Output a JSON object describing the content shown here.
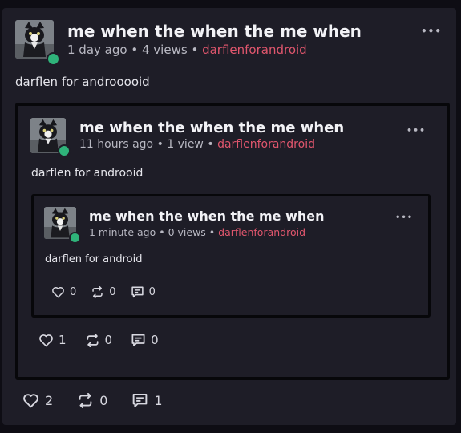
{
  "outer": {
    "title": "me when the when the me when",
    "time": "1 day ago",
    "views": "4 views",
    "author": "darflenforandroid",
    "body": "darflen for androoooid",
    "likes": "2",
    "reposts": "0",
    "comments": "1"
  },
  "quote1": {
    "title": "me when the when the me when",
    "time": "11 hours ago",
    "views": "1 view",
    "author": "darflenforandroid",
    "body": "darflen for androoid",
    "likes": "1",
    "reposts": "0",
    "comments": "0"
  },
  "quote2": {
    "title": "me when the when the me when",
    "time": "1 minute ago",
    "views": "0 views",
    "author": "darflenforandroid",
    "body": "darflen for android",
    "likes": "0",
    "reposts": "0",
    "comments": "0"
  },
  "ui": {
    "separator": "•",
    "more_glyph": "•••"
  },
  "icons": {
    "like": "heart-icon",
    "repost": "repost-icon",
    "comment": "comment-icon",
    "more": "more-options-icon"
  },
  "colors": {
    "background": "#0e0d14",
    "card": "#1e1d27",
    "author": "#e0566d",
    "online": "#2fb37a"
  }
}
